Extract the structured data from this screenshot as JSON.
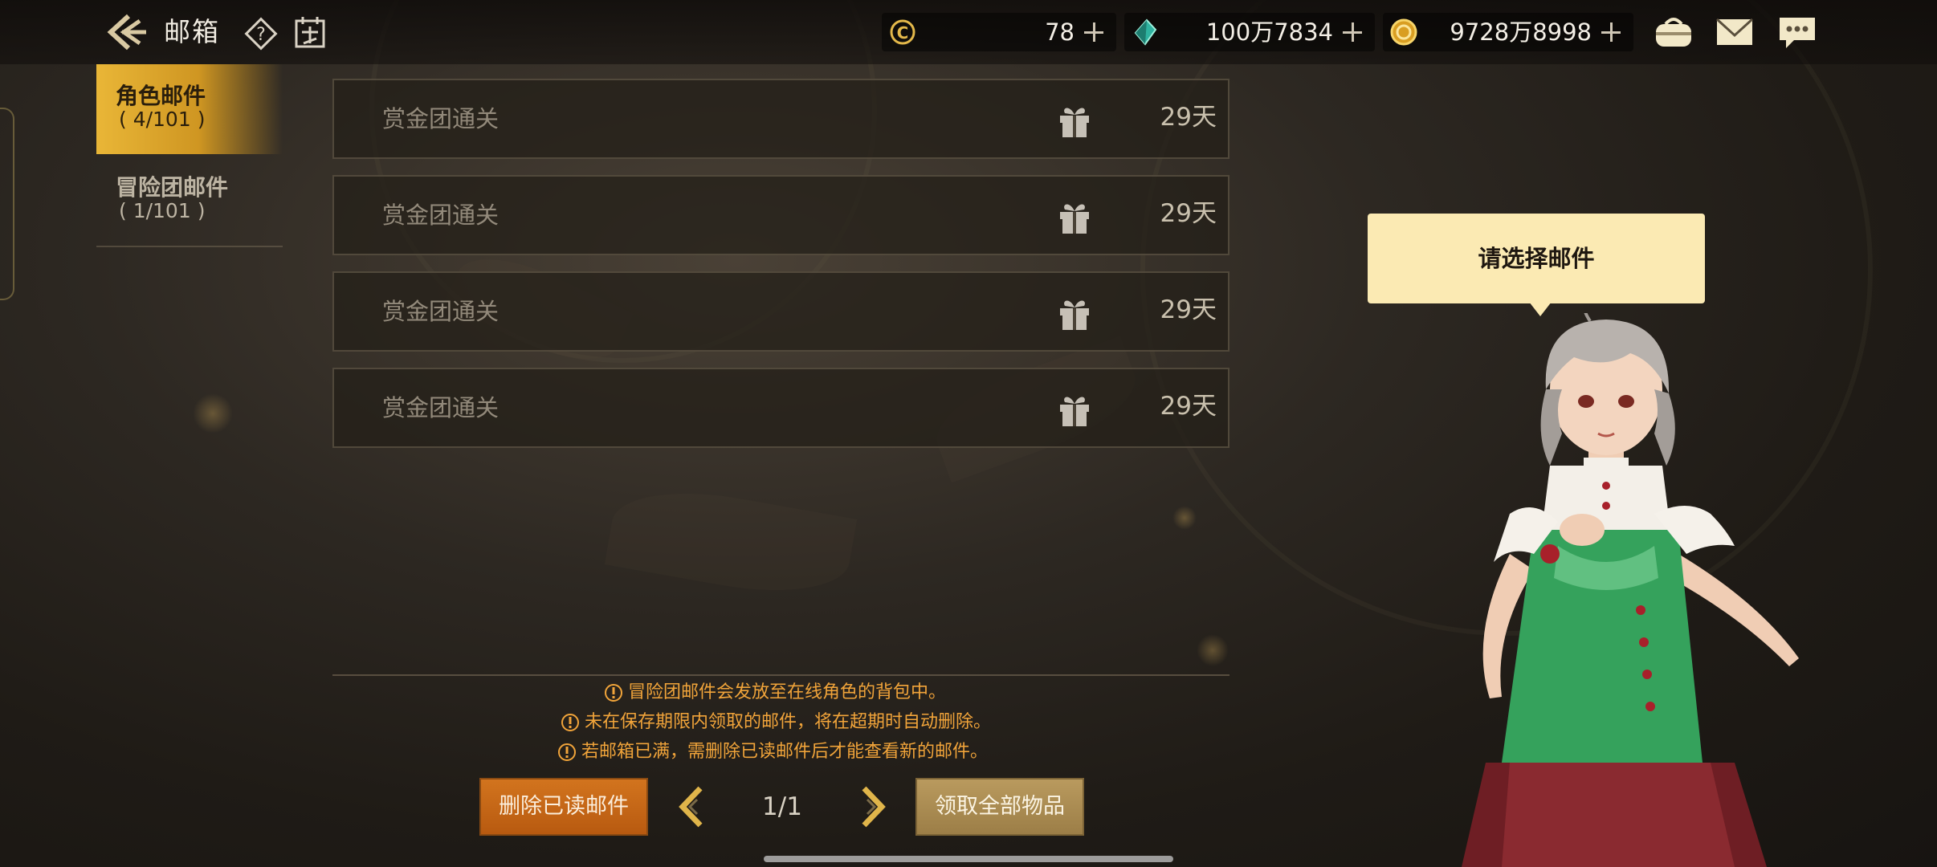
{
  "header": {
    "title": "邮箱",
    "currencies": [
      {
        "icon": "c-coin-icon",
        "value": "78"
      },
      {
        "icon": "crystal-icon",
        "value": "100万7834"
      },
      {
        "icon": "gold-coin-icon",
        "value": "9728万8998"
      }
    ],
    "right_icons": [
      "bag-icon",
      "mail-icon",
      "chat-icon"
    ]
  },
  "tabs": [
    {
      "label": "角色邮件",
      "count": "( 4/101 )",
      "active": true
    },
    {
      "label": "冒险团邮件",
      "count": "( 1/101 )",
      "active": false
    }
  ],
  "mails": [
    {
      "title": "赏金团通关",
      "days": "29天",
      "icon": "gift-icon"
    },
    {
      "title": "赏金团通关",
      "days": "29天",
      "icon": "gift-icon"
    },
    {
      "title": "赏金团通关",
      "days": "29天",
      "icon": "gift-icon"
    },
    {
      "title": "赏金团通关",
      "days": "29天",
      "icon": "gift-icon"
    }
  ],
  "notices": [
    "冒险团邮件会发放至在线角色的背包中。",
    "未在保存期限内领取的邮件，将在超期时自动删除。",
    "若邮箱已满，需删除已读邮件后才能查看新的邮件。"
  ],
  "footer": {
    "delete_label": "删除已读邮件",
    "page": "1/1",
    "claim_label": "领取全部物品"
  },
  "right_panel": {
    "bubble": "请选择邮件"
  },
  "colors": {
    "accent_gold": "#e9b637",
    "notice_orange": "#f1a43a",
    "delete_orange": "#d2741e",
    "claim_tan": "#b99a5e",
    "bubble_cream": "#fbeab3"
  }
}
